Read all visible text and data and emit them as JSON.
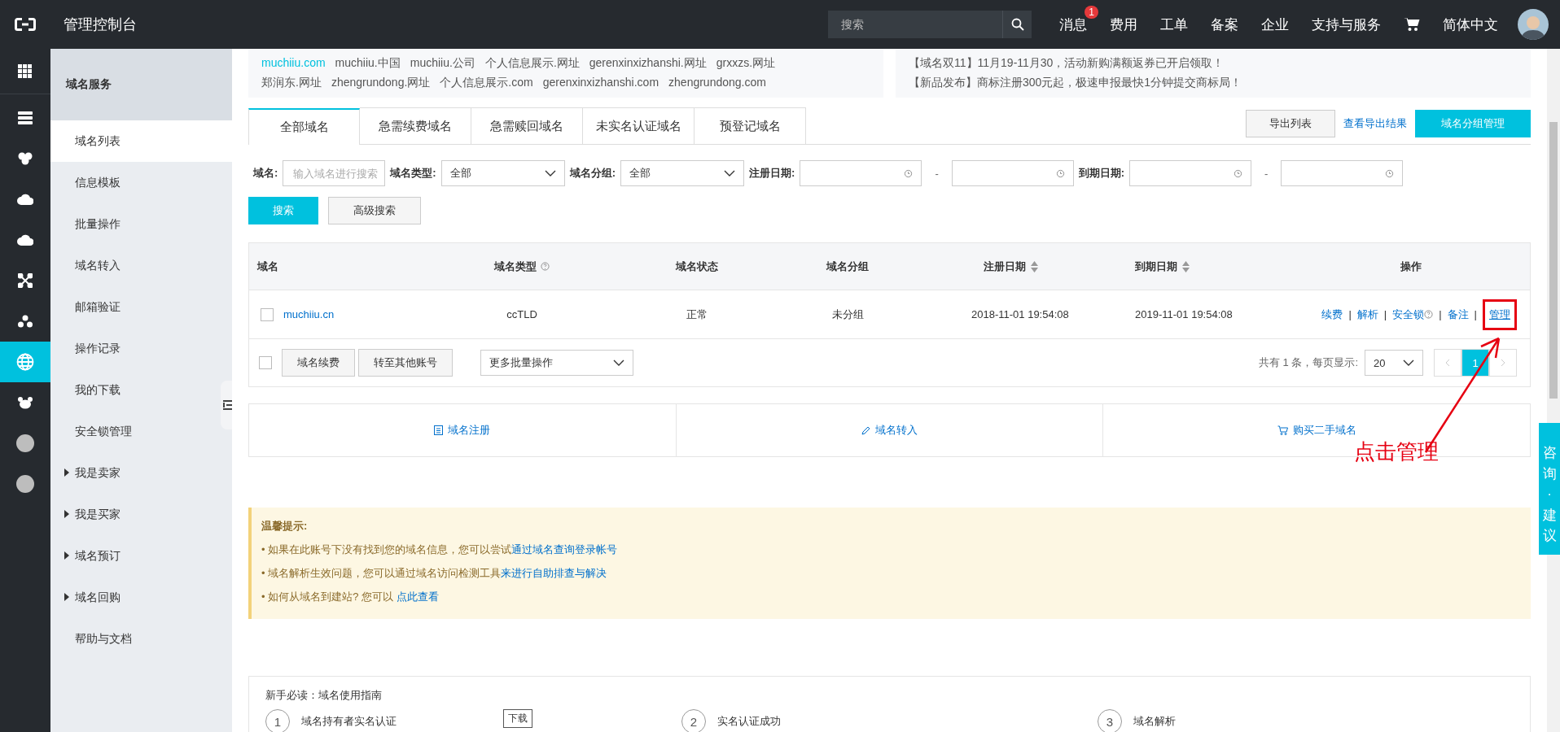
{
  "topbar": {
    "title": "管理控制台",
    "search": {
      "placeholder": "搜索"
    },
    "nav": [
      {
        "kind": "text",
        "label": "消息",
        "badge": "1"
      },
      {
        "kind": "text",
        "label": "费用"
      },
      {
        "kind": "text",
        "label": "工单"
      },
      {
        "kind": "text",
        "label": "备案"
      },
      {
        "kind": "text",
        "label": "企业"
      },
      {
        "kind": "text",
        "label": "支持与服务"
      },
      {
        "kind": "cart"
      },
      {
        "kind": "text",
        "label": "简体中文"
      },
      {
        "kind": "avatar"
      }
    ]
  },
  "rail": [
    {
      "kind": "grid",
      "selected": false
    },
    {
      "kind": "server",
      "selected": false
    },
    {
      "kind": "cluster",
      "selected": false
    },
    {
      "kind": "cloud",
      "selected": false
    },
    {
      "kind": "cloud",
      "selected": false
    },
    {
      "kind": "network",
      "selected": false
    },
    {
      "kind": "nodes",
      "selected": false
    },
    {
      "kind": "globe",
      "selected": true
    },
    {
      "kind": "bug",
      "selected": false
    },
    {
      "kind": "dot",
      "selected": false
    },
    {
      "kind": "dot",
      "selected": false
    }
  ],
  "sidebar": {
    "title": "域名服务",
    "items": [
      {
        "label": "域名列表",
        "selected": true
      },
      {
        "label": "信息模板",
        "selected": false
      },
      {
        "label": "批量操作",
        "selected": false
      },
      {
        "label": "域名转入",
        "selected": false
      },
      {
        "label": "邮箱验证",
        "selected": false
      },
      {
        "label": "操作记录",
        "selected": false
      },
      {
        "label": "我的下载",
        "selected": false
      },
      {
        "label": "安全锁管理",
        "selected": false
      },
      {
        "label": "我是卖家",
        "selected": false,
        "expanded": false
      },
      {
        "label": "我是买家",
        "selected": false,
        "expanded": false
      },
      {
        "label": "域名预订",
        "selected": false,
        "expanded": false
      },
      {
        "label": "域名回购",
        "selected": false,
        "expanded": false
      },
      {
        "label": "帮助与文档",
        "selected": false
      }
    ]
  },
  "promo": {
    "domains": [
      [
        "muchiiu.com",
        "muchiiu.中国",
        "muchiiu.公司",
        "个人信息展示.网址",
        "gerenxinxizhanshi.网址",
        "grxxzs.网址"
      ],
      [
        "郑润东.网址",
        "zhengrundong.网址",
        "个人信息展示.com",
        "gerenxinxizhanshi.com",
        "zhengrundong.com"
      ]
    ],
    "news": [
      "【域名双11】11月19-11月30，活动新购满额返券已开启领取！",
      "【新品发布】商标注册300元起，极速申报最快1分钟提交商标局！"
    ]
  },
  "tabs": [
    {
      "label": "全部域名",
      "selected": true
    },
    {
      "label": "急需续费域名",
      "selected": false
    },
    {
      "label": "急需赎回域名",
      "selected": false
    },
    {
      "label": "未实名认证域名",
      "selected": false
    },
    {
      "label": "预登记域名",
      "selected": false
    }
  ],
  "tab_actions": {
    "export": "导出列表",
    "view_export": "查看导出结果",
    "group_manage": "域名分组管理"
  },
  "filters": {
    "domain_label": "域名:",
    "domain_placeholder": "输入域名进行搜索",
    "type_label": "域名类型:",
    "type_value": "全部",
    "group_label": "域名分组:",
    "group_value": "全部",
    "reg_label": "注册日期:",
    "exp_label": "到期日期:",
    "dash": "-",
    "search": "搜索",
    "advanced": "高级搜索"
  },
  "table": {
    "columns": [
      {
        "label": "域名",
        "kind": "plain"
      },
      {
        "label": "域名类型",
        "kind": "help"
      },
      {
        "label": "域名状态",
        "kind": "plain"
      },
      {
        "label": "域名分组",
        "kind": "plain"
      },
      {
        "label": "注册日期",
        "kind": "sort"
      },
      {
        "label": "到期日期",
        "kind": "sort"
      },
      {
        "label": "操作",
        "kind": "plain"
      }
    ],
    "rows": [
      {
        "checked": false,
        "domain": "muchiiu.cn",
        "type": "ccTLD",
        "status": "正常",
        "group": "未分组",
        "registered": "2018-11-01 19:54:08",
        "expires": "2019-11-01 19:54:08",
        "actions": [
          {
            "label": "续费",
            "kind": "plain",
            "highlighted": false
          },
          {
            "label": "解析",
            "kind": "plain",
            "highlighted": false
          },
          {
            "label": "安全锁",
            "kind": "help",
            "highlighted": false
          },
          {
            "label": "备注",
            "kind": "plain",
            "highlighted": false
          },
          {
            "label": "管理",
            "kind": "plain",
            "highlighted": true
          }
        ]
      }
    ],
    "separator": "|",
    "batch": {
      "checked": false,
      "buttons": [
        "域名续费",
        "转至其他账号"
      ],
      "more": "更多批量操作",
      "total": "共有 1 条，每页显示:",
      "page_size": "20",
      "pages": [
        {
          "label": "1",
          "selected": true
        }
      ]
    }
  },
  "quick_links": [
    {
      "kind": "doc",
      "label": "域名注册"
    },
    {
      "kind": "pen",
      "label": "域名转入"
    },
    {
      "kind": "cart",
      "label": "购买二手域名"
    }
  ],
  "notice": {
    "title": "温馨提示:",
    "bullet": "•",
    "lines": [
      {
        "text": "如果在此账号下没有找到您的域名信息，您可以尝试",
        "link": "通过域名查询登录帐号"
      },
      {
        "text": "域名解析生效问题，您可以通过域名访问检测工具",
        "link": "来进行自助排查与解决"
      },
      {
        "text": "如何从域名到建站? 您可以 ",
        "link": "点此查看"
      }
    ]
  },
  "guide": {
    "title": "新手必读：域名使用指南",
    "steps": [
      {
        "num": "1",
        "label": "域名持有者实名认证"
      },
      {
        "num": "2",
        "label": "实名认证成功"
      },
      {
        "num": "3",
        "label": "域名解析"
      }
    ],
    "tooltip": "下载"
  },
  "consult": "咨询·建议",
  "annotation": "点击管理"
}
